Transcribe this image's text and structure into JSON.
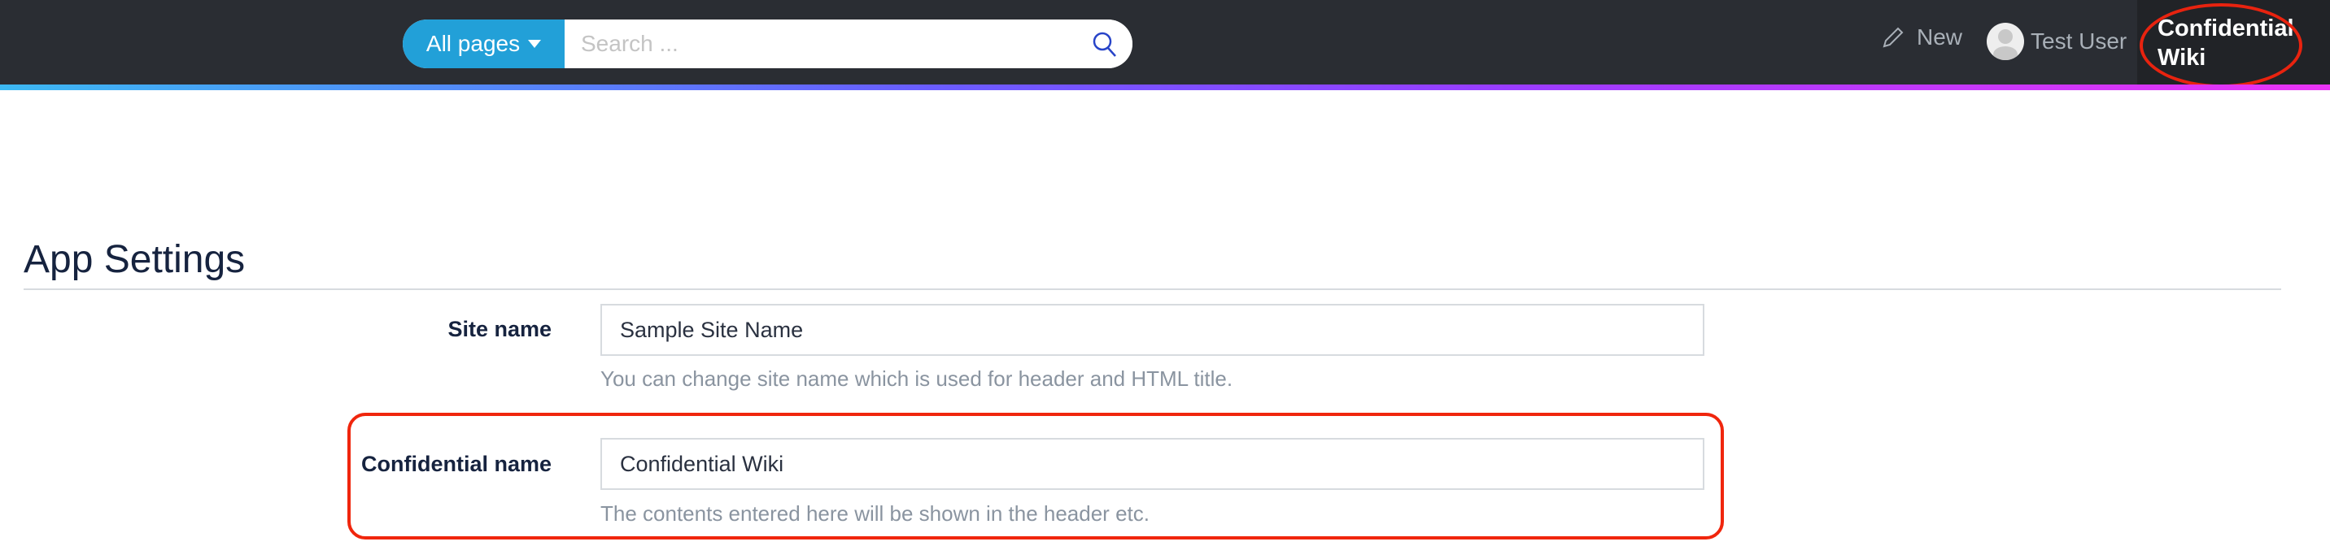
{
  "header": {
    "scope_label": "All pages",
    "search_placeholder": "Search ...",
    "new_label": "New",
    "user_name": "Test User",
    "confidential_line1": "Confidential",
    "confidential_line2": "Wiki"
  },
  "page": {
    "title": "App Settings",
    "fields": [
      {
        "label": "Site name",
        "value": "Sample Site Name",
        "help": "You can change site name which is used for header and HTML title."
      },
      {
        "label": "Confidential name",
        "value": "Confidential Wiki",
        "help": "The contents entered here will be shown in the header etc."
      }
    ]
  },
  "colors": {
    "accent": "#22a0d8",
    "header_bg": "#2a2d33",
    "highlight": "#f0260d"
  }
}
